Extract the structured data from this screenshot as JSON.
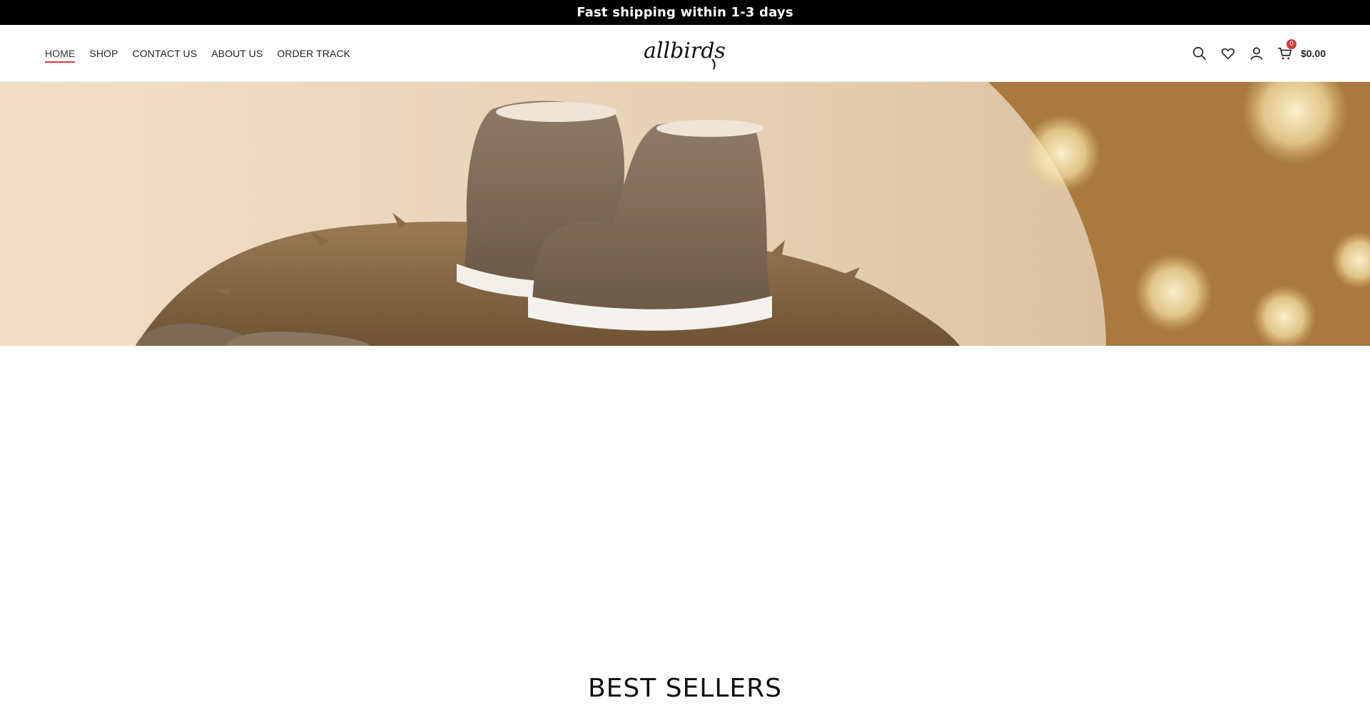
{
  "announcement": {
    "text": "Fast shipping within 1-3 days"
  },
  "nav": {
    "items": [
      {
        "label": "HOME",
        "active": true
      },
      {
        "label": "SHOP",
        "active": false
      },
      {
        "label": "CONTACT US",
        "active": false
      },
      {
        "label": "ABOUT US",
        "active": false
      },
      {
        "label": "ORDER TRACK",
        "active": false
      }
    ]
  },
  "brand": {
    "logo_text": "allbirds"
  },
  "header_actions": {
    "icons": [
      "search-icon",
      "heart-icon",
      "user-icon",
      "cart-icon"
    ],
    "cart_count": "0",
    "cart_total": "$0.00"
  },
  "sections": {
    "best_sellers_title": "BEST SELLERS"
  },
  "colors": {
    "accent": "#d63b3b",
    "topbar_bg": "#000000",
    "hero_warm": "#a9793f"
  }
}
